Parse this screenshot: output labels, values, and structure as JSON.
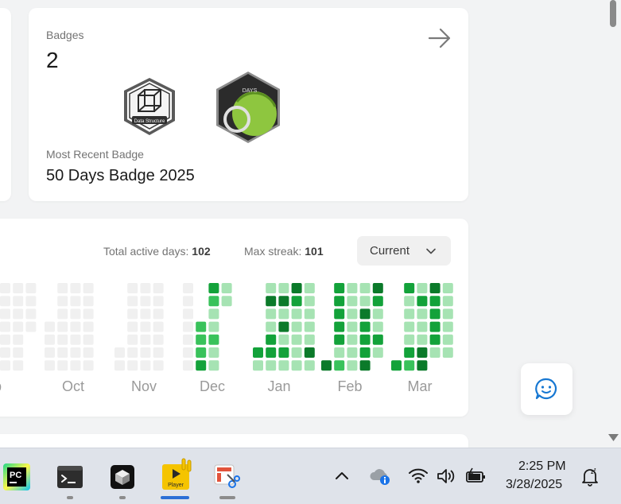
{
  "badges_card": {
    "label": "Badges",
    "count": "2",
    "recent_label": "Most Recent Badge",
    "recent_name": "50 Days Badge 2025",
    "badges": [
      {
        "name": "Data Structure",
        "icon": "data-structure-badge"
      },
      {
        "name": "DAYS",
        "icon": "50-days-badge"
      }
    ]
  },
  "calendar": {
    "total_active_label": "Total active days:",
    "total_active_value": "102",
    "max_streak_label": "Max streak:",
    "max_streak_value": "101",
    "select_value": "Current",
    "months": [
      "ep",
      "Oct",
      "Nov",
      "Dec",
      "Jan",
      "Feb",
      "Mar"
    ],
    "colors": {
      "empty": "#f0f0f0",
      "level1": "#a6e3b3",
      "level2": "#39c25b",
      "level3": "#13a23a",
      "level4": "#0b7a2a"
    }
  },
  "taskbar": {
    "apps": [
      "pycharm-icon",
      "terminal-icon",
      "cube-app-icon",
      "player-icon",
      "snipping-tool-icon"
    ],
    "player_label": "Player",
    "pycharm_label": "PC",
    "time": "2:25 PM",
    "date": "3/28/2025"
  }
}
